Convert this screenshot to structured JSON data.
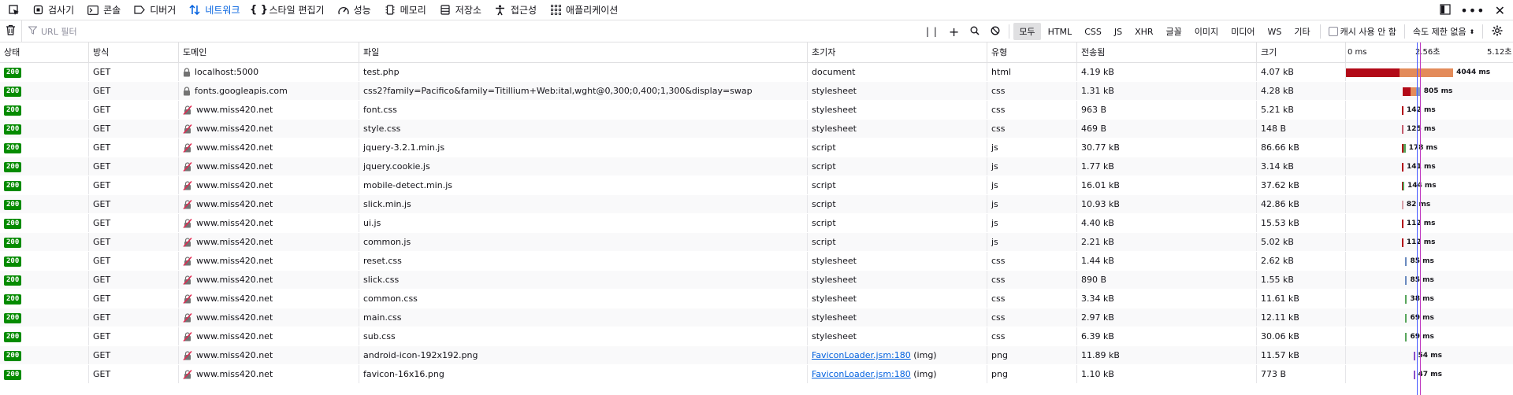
{
  "toolbar": {
    "tabs": [
      {
        "label": "검사기",
        "icon": "inspector-icon"
      },
      {
        "label": "콘솔",
        "icon": "console-icon"
      },
      {
        "label": "디버거",
        "icon": "debugger-icon"
      },
      {
        "label": "네트워크",
        "icon": "network-icon",
        "active": true
      },
      {
        "label": "스타일 편집기",
        "icon": "style-editor-icon"
      },
      {
        "label": "성능",
        "icon": "performance-icon"
      },
      {
        "label": "메모리",
        "icon": "memory-icon"
      },
      {
        "label": "저장소",
        "icon": "storage-icon"
      },
      {
        "label": "접근성",
        "icon": "accessibility-icon"
      },
      {
        "label": "애플리케이션",
        "icon": "application-icon"
      }
    ]
  },
  "filter": {
    "placeholder": "URL 필터",
    "types": [
      "모두",
      "HTML",
      "CSS",
      "JS",
      "XHR",
      "글꼴",
      "이미지",
      "미디어",
      "WS",
      "기타"
    ],
    "selected_type": "모두",
    "disable_cache_label": "캐시 사용 안 함",
    "throttle_label": "속도 제한 없음"
  },
  "columns": [
    "상태",
    "방식",
    "도메인",
    "파일",
    "초기자",
    "유형",
    "전송됨",
    "크기"
  ],
  "timeline_ticks": [
    "0 ms",
    "2.56초",
    "5.12초"
  ],
  "rows": [
    {
      "status": "200",
      "method": "GET",
      "domain": "localhost:5000",
      "lock": "secure",
      "file": "test.php",
      "initiator": "document",
      "type": "html",
      "transferred": "4.19 kB",
      "size": "4.07 kB",
      "timing": "4044 ms",
      "bars": [
        {
          "start": 0,
          "dur": 0.37,
          "color": "#b20a18"
        },
        {
          "start": 0.37,
          "dur": 0.37,
          "color": "#e38b5a"
        }
      ]
    },
    {
      "status": "200",
      "method": "GET",
      "domain": "fonts.googleapis.com",
      "lock": "secure",
      "file": "css2?family=Pacifico&family=Titillium+Web:ital,wght@0,300;0,400;1,300&display=swap",
      "initiator": "stylesheet",
      "type": "css",
      "transferred": "1.31 kB",
      "size": "4.28 kB",
      "timing": "805 ms",
      "bars": [
        {
          "start": 0.39,
          "dur": 0.055,
          "color": "#b20a18"
        },
        {
          "start": 0.445,
          "dur": 0.04,
          "color": "#e38b5a"
        },
        {
          "start": 0.485,
          "dur": 0.03,
          "color": "#8899bb"
        }
      ]
    },
    {
      "status": "200",
      "method": "GET",
      "domain": "www.miss420.net",
      "lock": "insecure",
      "file": "font.css",
      "initiator": "stylesheet",
      "type": "css",
      "transferred": "963 B",
      "size": "5.21 kB",
      "timing": "142 ms",
      "bars": [
        {
          "start": 0.385,
          "dur": 0.012,
          "color": "#b20a18"
        }
      ]
    },
    {
      "status": "200",
      "method": "GET",
      "domain": "www.miss420.net",
      "lock": "insecure",
      "file": "style.css",
      "initiator": "stylesheet",
      "type": "css",
      "transferred": "469 B",
      "size": "148 B",
      "timing": "125 ms",
      "bars": [
        {
          "start": 0.385,
          "dur": 0.012,
          "color": "#c45c6c"
        }
      ]
    },
    {
      "status": "200",
      "method": "GET",
      "domain": "www.miss420.net",
      "lock": "insecure",
      "file": "jquery-3.2.1.min.js",
      "initiator": "script",
      "type": "js",
      "transferred": "30.77 kB",
      "size": "86.66 kB",
      "timing": "178 ms",
      "bars": [
        {
          "start": 0.385,
          "dur": 0.014,
          "color": "#b20a18"
        },
        {
          "start": 0.399,
          "dur": 0.012,
          "color": "#58a55c"
        }
      ]
    },
    {
      "status": "200",
      "method": "GET",
      "domain": "www.miss420.net",
      "lock": "insecure",
      "file": "jquery.cookie.js",
      "initiator": "script",
      "type": "js",
      "transferred": "1.77 kB",
      "size": "3.14 kB",
      "timing": "141 ms",
      "bars": [
        {
          "start": 0.385,
          "dur": 0.012,
          "color": "#b20a18"
        }
      ]
    },
    {
      "status": "200",
      "method": "GET",
      "domain": "www.miss420.net",
      "lock": "insecure",
      "file": "mobile-detect.min.js",
      "initiator": "script",
      "type": "js",
      "transferred": "16.01 kB",
      "size": "37.62 kB",
      "timing": "144 ms",
      "bars": [
        {
          "start": 0.385,
          "dur": 0.006,
          "color": "#b20a18"
        },
        {
          "start": 0.391,
          "dur": 0.008,
          "color": "#58a55c"
        }
      ]
    },
    {
      "status": "200",
      "method": "GET",
      "domain": "www.miss420.net",
      "lock": "insecure",
      "file": "slick.min.js",
      "initiator": "script",
      "type": "js",
      "transferred": "10.93 kB",
      "size": "42.86 kB",
      "timing": "82 ms",
      "bars": [
        {
          "start": 0.385,
          "dur": 0.006,
          "color": "#d8a0a8"
        }
      ]
    },
    {
      "status": "200",
      "method": "GET",
      "domain": "www.miss420.net",
      "lock": "insecure",
      "file": "ui.js",
      "initiator": "script",
      "type": "js",
      "transferred": "4.40 kB",
      "size": "15.53 kB",
      "timing": "112 ms",
      "bars": [
        {
          "start": 0.385,
          "dur": 0.01,
          "color": "#b20a18"
        }
      ]
    },
    {
      "status": "200",
      "method": "GET",
      "domain": "www.miss420.net",
      "lock": "insecure",
      "file": "common.js",
      "initiator": "script",
      "type": "js",
      "transferred": "2.21 kB",
      "size": "5.02 kB",
      "timing": "112 ms",
      "bars": [
        {
          "start": 0.385,
          "dur": 0.01,
          "color": "#b20a18"
        }
      ]
    },
    {
      "status": "200",
      "method": "GET",
      "domain": "www.miss420.net",
      "lock": "insecure",
      "file": "reset.css",
      "initiator": "stylesheet",
      "type": "css",
      "transferred": "1.44 kB",
      "size": "2.62 kB",
      "timing": "85 ms",
      "bars": [
        {
          "start": 0.41,
          "dur": 0.008,
          "color": "#6a8abf"
        }
      ]
    },
    {
      "status": "200",
      "method": "GET",
      "domain": "www.miss420.net",
      "lock": "insecure",
      "file": "slick.css",
      "initiator": "stylesheet",
      "type": "css",
      "transferred": "890 B",
      "size": "1.55 kB",
      "timing": "85 ms",
      "bars": [
        {
          "start": 0.41,
          "dur": 0.008,
          "color": "#6a8abf"
        }
      ]
    },
    {
      "status": "200",
      "method": "GET",
      "domain": "www.miss420.net",
      "lock": "insecure",
      "file": "common.css",
      "initiator": "stylesheet",
      "type": "css",
      "transferred": "3.34 kB",
      "size": "11.61 kB",
      "timing": "38 ms",
      "bars": [
        {
          "start": 0.41,
          "dur": 0.006,
          "color": "#58a55c"
        }
      ]
    },
    {
      "status": "200",
      "method": "GET",
      "domain": "www.miss420.net",
      "lock": "insecure",
      "file": "main.css",
      "initiator": "stylesheet",
      "type": "css",
      "transferred": "2.97 kB",
      "size": "12.11 kB",
      "timing": "69 ms",
      "bars": [
        {
          "start": 0.41,
          "dur": 0.008,
          "color": "#58a55c"
        }
      ]
    },
    {
      "status": "200",
      "method": "GET",
      "domain": "www.miss420.net",
      "lock": "insecure",
      "file": "sub.css",
      "initiator": "stylesheet",
      "type": "css",
      "transferred": "6.39 kB",
      "size": "30.06 kB",
      "timing": "69 ms",
      "bars": [
        {
          "start": 0.41,
          "dur": 0.008,
          "color": "#58a55c"
        }
      ]
    },
    {
      "status": "200",
      "method": "GET",
      "domain": "www.miss420.net",
      "lock": "insecure",
      "file": "android-icon-192x192.png",
      "initiator_link": "FaviconLoader.jsm:180",
      "initiator_suffix": "(img)",
      "type": "png",
      "transferred": "11.89 kB",
      "size": "11.57 kB",
      "timing": "54 ms",
      "bars": [
        {
          "start": 0.465,
          "dur": 0.008,
          "color": "#8a4fc8"
        }
      ]
    },
    {
      "status": "200",
      "method": "GET",
      "domain": "www.miss420.net",
      "lock": "insecure",
      "file": "favicon-16x16.png",
      "initiator_link": "FaviconLoader.jsm:180",
      "initiator_suffix": "(img)",
      "type": "png",
      "transferred": "1.10 kB",
      "size": "773 B",
      "timing": "47 ms",
      "bars": [
        {
          "start": 0.465,
          "dur": 0.008,
          "color": "#8a4fc8"
        }
      ]
    }
  ]
}
